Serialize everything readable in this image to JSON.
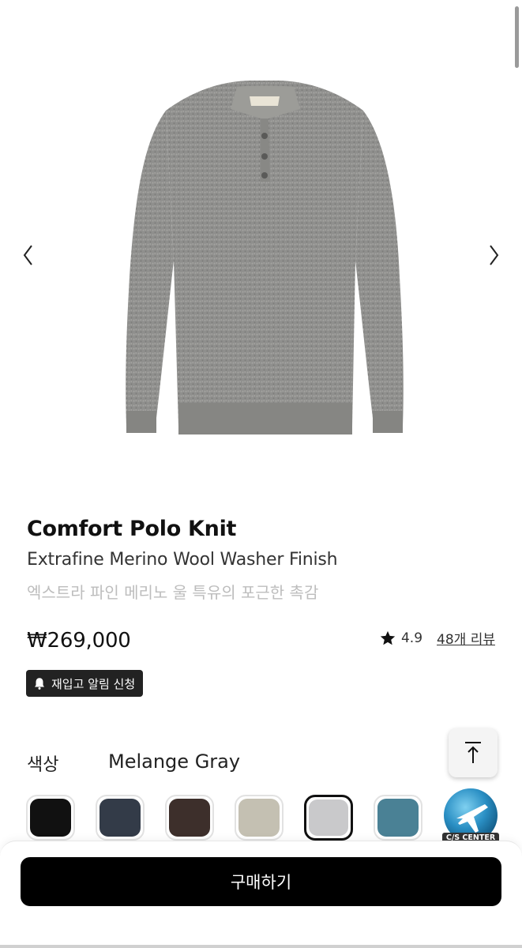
{
  "gallery": {
    "prev_icon": "chevron-left-icon",
    "next_icon": "chevron-right-icon",
    "image": "gray-polo-knit-sweater"
  },
  "product": {
    "title": "Comfort Polo Knit",
    "subtitle_en": "Extrafine Merino Wool Washer Finish",
    "subtitle_ko": "엑스트라 파인 메리노 울 특유의 포근한 촉감",
    "price": "₩269,000",
    "rating_icon": "star-icon",
    "rating": "4.9",
    "reviews_link": "48개 리뷰"
  },
  "restock": {
    "icon": "bell-icon",
    "label": "재입고 알림 신청"
  },
  "color": {
    "label": "색상",
    "selected_name": "Melange Gray",
    "swatches": [
      {
        "color": "#111111",
        "selected": false
      },
      {
        "color": "#333b48",
        "selected": false
      },
      {
        "color": "#3d2f2b",
        "selected": false
      },
      {
        "color": "#c4c0b2",
        "selected": false
      },
      {
        "color": "#c9c9cb",
        "selected": true
      },
      {
        "color": "#4a8195",
        "selected": false
      }
    ]
  },
  "floating": {
    "top_icon": "arrow-up-to-top-icon",
    "cs_label": "C/S CENTER"
  },
  "cta": {
    "buy_label": "구매하기"
  }
}
